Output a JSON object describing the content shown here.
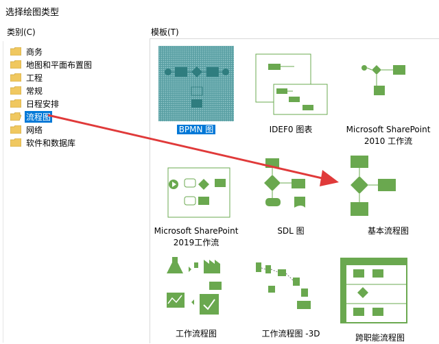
{
  "window": {
    "title": "选择绘图类型"
  },
  "categories": {
    "header": "类别(C)",
    "items": [
      {
        "label": "商务"
      },
      {
        "label": "地图和平面布置图"
      },
      {
        "label": "工程"
      },
      {
        "label": "常规"
      },
      {
        "label": "日程安排"
      },
      {
        "label": "流程图",
        "selected": true
      },
      {
        "label": "网络"
      },
      {
        "label": "软件和数据库"
      }
    ]
  },
  "templates": {
    "header": "模板(T)",
    "items": [
      {
        "label": "BPMN 图",
        "selected": true
      },
      {
        "label": "IDEF0 图表"
      },
      {
        "label": "Microsoft SharePoint 2010 工作流"
      },
      {
        "label": "Microsoft SharePoint 2019工作流"
      },
      {
        "label": "SDL 图"
      },
      {
        "label": "基本流程图"
      },
      {
        "label": "工作流程图"
      },
      {
        "label": "工作流程图 -3D"
      },
      {
        "label": "跨职能流程图"
      }
    ]
  },
  "colors": {
    "accent": "#0078d7",
    "shape_green": "#6aa84f",
    "arrow_red": "#e03a3a",
    "folder": "#f0c860"
  }
}
